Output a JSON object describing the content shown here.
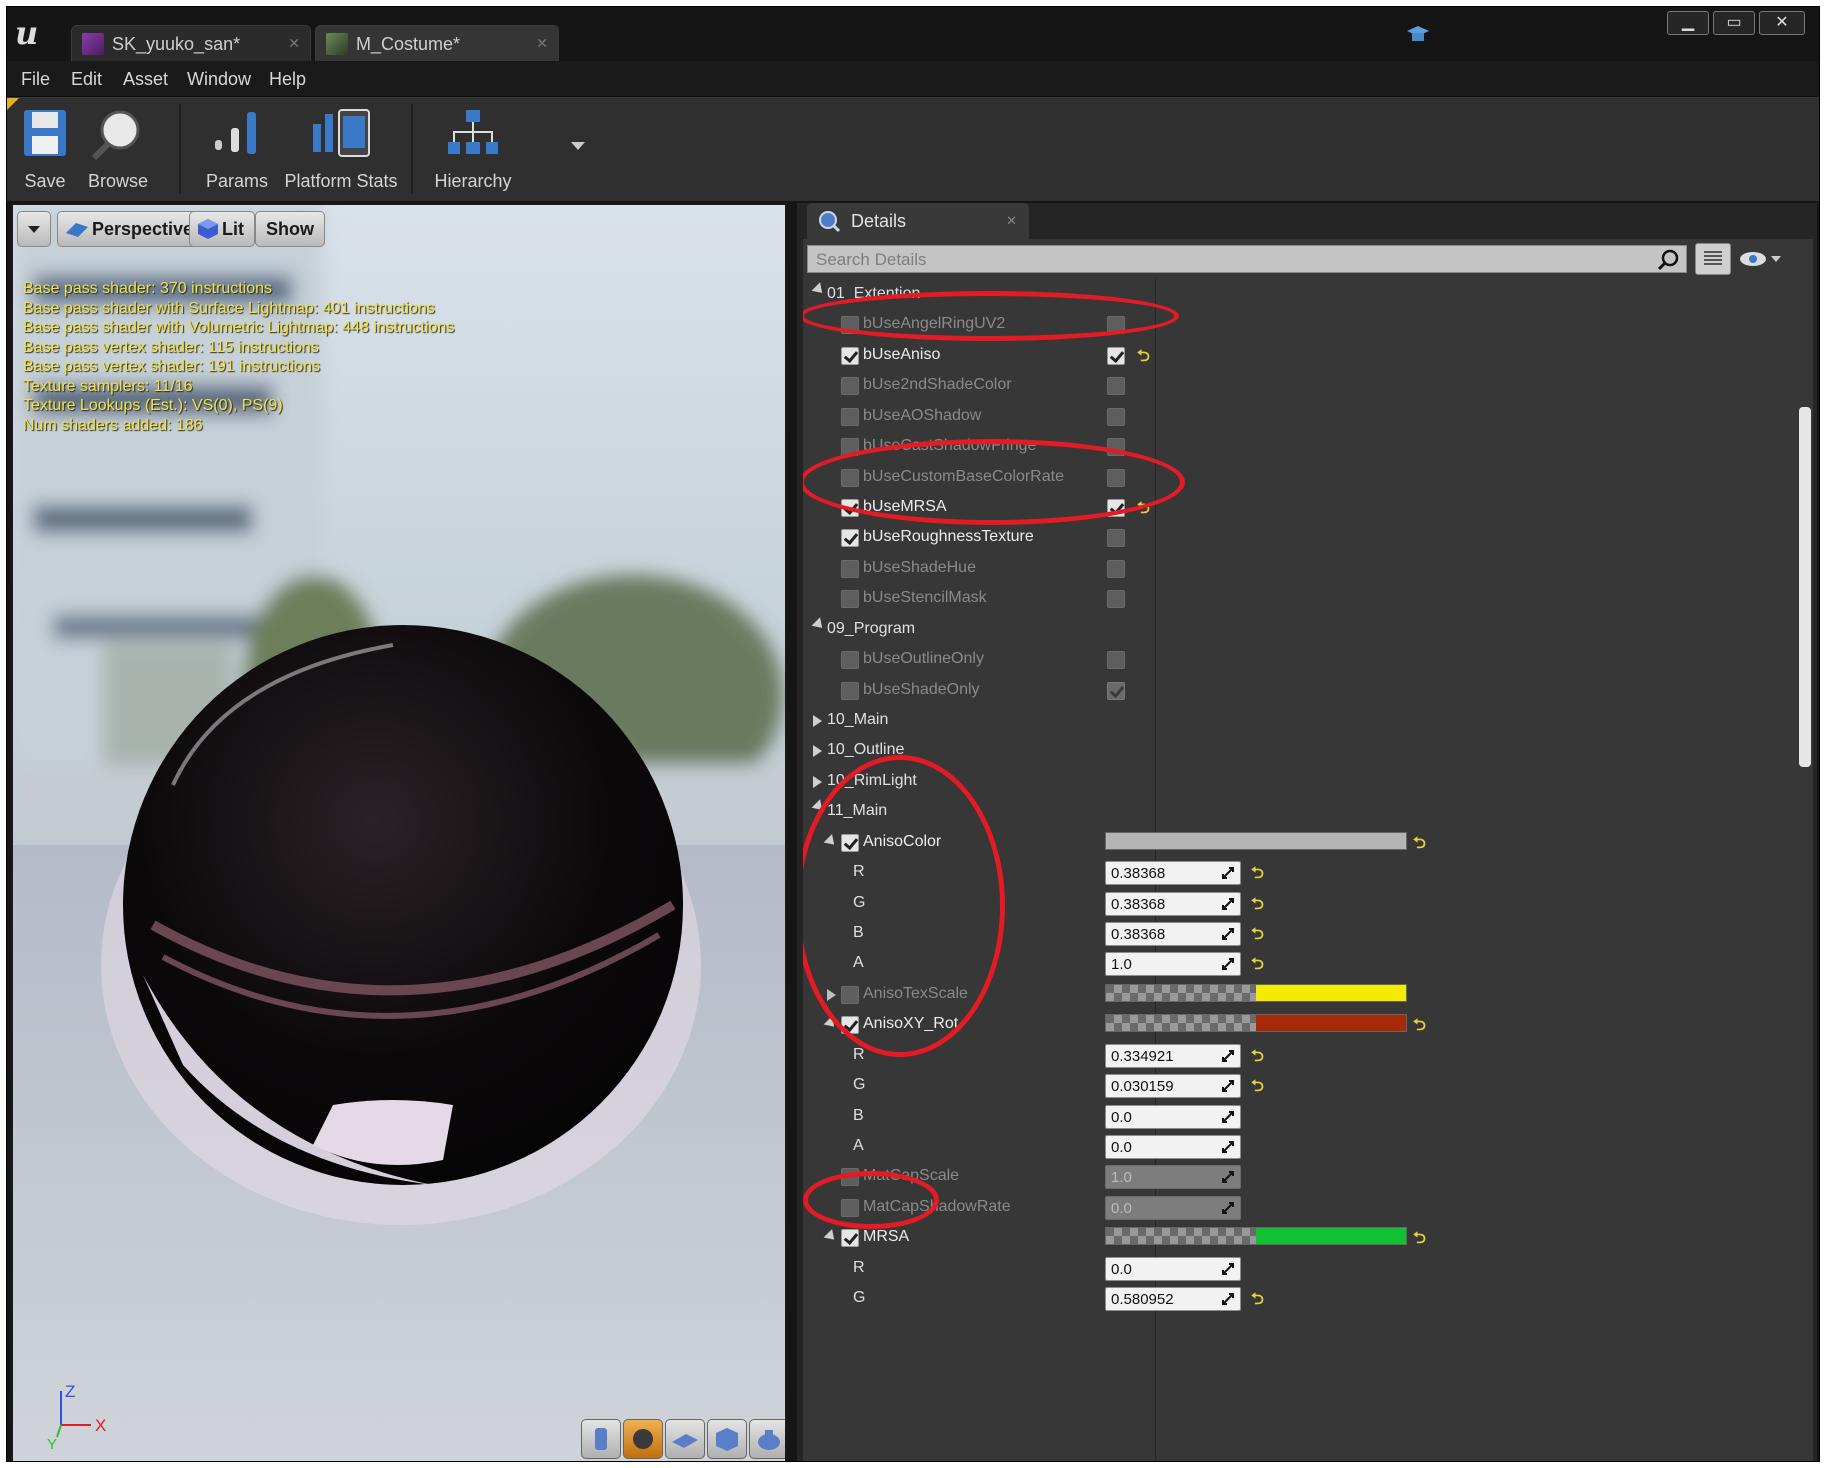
{
  "tabs": [
    {
      "label": "SK_yuuko_san*",
      "icon": "skeletal-mesh-icon"
    },
    {
      "label": "M_Costume*",
      "icon": "material-icon"
    }
  ],
  "menu": [
    "File",
    "Edit",
    "Asset",
    "Window",
    "Help"
  ],
  "toolbar": {
    "save": "Save",
    "browse": "Browse",
    "params": "Params",
    "platform_stats": "Platform Stats",
    "hierarchy": "Hierarchy"
  },
  "viewport": {
    "perspective": "Perspective",
    "lit": "Lit",
    "show": "Show",
    "stats": [
      "Base pass shader: 370 instructions",
      "Base pass shader with Surface Lightmap: 401 instructions",
      "Base pass shader with Volumetric Lightmap: 448 instructions",
      "Base pass vertex shader: 115 instructions",
      "Base pass vertex shader: 191 instructions",
      "Texture samplers: 11/16",
      "Texture Lookups (Est.): VS(0), PS(9)",
      "Num shaders added: 186"
    ],
    "axis_z": "Z",
    "axis_x": "X",
    "axis_y": "Y"
  },
  "details": {
    "tab_label": "Details",
    "search_placeholder": "Search Details",
    "rows": [
      {
        "type": "cat",
        "label": "01_Extention",
        "open": true
      },
      {
        "type": "bool",
        "label": "bUseAngelRingUV2",
        "override": false,
        "value": false
      },
      {
        "type": "bool",
        "label": "bUseAniso",
        "override": true,
        "value": true,
        "reset": true
      },
      {
        "type": "bool",
        "label": "bUse2ndShadeColor",
        "override": false,
        "value": false
      },
      {
        "type": "bool",
        "label": "bUseAOShadow",
        "override": false,
        "value": false
      },
      {
        "type": "bool",
        "label": "bUseCastShadowFringe",
        "override": false,
        "value": false
      },
      {
        "type": "bool",
        "label": "bUseCustomBaseColorRate",
        "override": false,
        "value": false
      },
      {
        "type": "bool",
        "label": "bUseMRSA",
        "override": true,
        "value": true,
        "reset": true
      },
      {
        "type": "bool",
        "label": "bUseRoughnessTexture",
        "override": true,
        "value": false
      },
      {
        "type": "bool",
        "label": "bUseShadeHue",
        "override": false,
        "value": false
      },
      {
        "type": "bool",
        "label": "bUseStencilMask",
        "override": false,
        "value": false
      },
      {
        "type": "cat",
        "label": "09_Program",
        "open": true
      },
      {
        "type": "bool",
        "label": "bUseOutlineOnly",
        "override": false,
        "value": false
      },
      {
        "type": "bool",
        "label": "bUseShadeOnly",
        "override": false,
        "value": true
      },
      {
        "type": "cat",
        "label": "10_Main",
        "open": false
      },
      {
        "type": "cat",
        "label": "10_Outline",
        "open": false
      },
      {
        "type": "cat",
        "label": "10_RimLight",
        "open": false
      },
      {
        "type": "cat",
        "label": "11_Main",
        "open": true
      },
      {
        "type": "color",
        "label": "AnisoColor",
        "override": true,
        "color": "#b4b4b4",
        "full": true,
        "reset": true,
        "expand": "open"
      },
      {
        "type": "num",
        "label": "R",
        "value": "0.38368",
        "reset": true
      },
      {
        "type": "num",
        "label": "G",
        "value": "0.38368",
        "reset": true
      },
      {
        "type": "num",
        "label": "B",
        "value": "0.38368",
        "reset": true
      },
      {
        "type": "num",
        "label": "A",
        "value": "1.0",
        "reset": true
      },
      {
        "type": "color",
        "label": "AnisoTexScale",
        "override": false,
        "color": "#f4ec00",
        "full": false,
        "expand": "closed"
      },
      {
        "type": "color",
        "label": "AnisoXY_Rot",
        "override": true,
        "color": "#a62a08",
        "full": false,
        "reset": true,
        "expand": "open"
      },
      {
        "type": "num",
        "label": "R",
        "value": "0.334921",
        "reset": true
      },
      {
        "type": "num",
        "label": "G",
        "value": "0.030159",
        "reset": true
      },
      {
        "type": "num",
        "label": "B",
        "value": "0.0"
      },
      {
        "type": "num",
        "label": "A",
        "value": "0.0"
      },
      {
        "type": "scalar",
        "label": "MatCapScale",
        "override": false,
        "value": "1.0"
      },
      {
        "type": "scalar",
        "label": "MatCapShadowRate",
        "override": false,
        "value": "0.0"
      },
      {
        "type": "color",
        "label": "MRSA",
        "override": true,
        "color": "#10c231",
        "full": false,
        "reset": true,
        "expand": "open"
      },
      {
        "type": "num",
        "label": "R",
        "value": "0.0"
      },
      {
        "type": "num",
        "label": "G",
        "value": "0.580952",
        "reset": true
      }
    ]
  },
  "colors": {
    "annotation_red": "#e41b25",
    "stats_yellow": "#f2e24a",
    "reset_yellow": "#e6d23a"
  }
}
